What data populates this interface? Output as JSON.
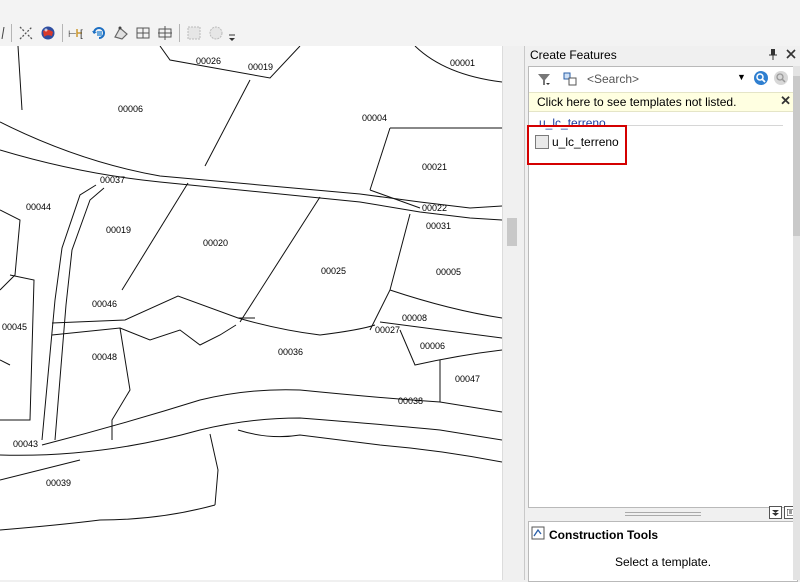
{
  "toolbar": {
    "icons": [
      "toolbar-edge-icon",
      "sketch-tool-icon",
      "globe-icon",
      "topology-icon",
      "rotate-icon",
      "reshape-icon",
      "split-icon",
      "align-icon",
      "disabled-tool-icon",
      "disabled-tool-2-icon",
      "overflow-icon"
    ]
  },
  "map": {
    "parcels": [
      {
        "id": "00026"
      },
      {
        "id": "00019"
      },
      {
        "id": "00001"
      },
      {
        "id": "00006"
      },
      {
        "id": "00004"
      },
      {
        "id": "00021"
      },
      {
        "id": "00037"
      },
      {
        "id": "00044"
      },
      {
        "id": "00022"
      },
      {
        "id": "00031"
      },
      {
        "id": "00019b",
        "label": "00019"
      },
      {
        "id": "00020"
      },
      {
        "id": "00025"
      },
      {
        "id": "00005"
      },
      {
        "id": "00046"
      },
      {
        "id": "00008"
      },
      {
        "id": "00045"
      },
      {
        "id": "00027"
      },
      {
        "id": "00006b",
        "label": "00006"
      },
      {
        "id": "00048"
      },
      {
        "id": "00036"
      },
      {
        "id": "00047"
      },
      {
        "id": "00038"
      },
      {
        "id": "00043"
      },
      {
        "id": "00039"
      }
    ]
  },
  "panel": {
    "title": "Create Features",
    "search_placeholder": "<Search>",
    "notice": "Click here to see templates not listed.",
    "layer_group": "u_lc_terreno",
    "template_label": "u_lc_terreno",
    "construction_title": "Construction Tools",
    "construction_placeholder": "Select a template."
  },
  "colors": {
    "highlight": "#d40000",
    "notice_bg": "#ffffe1",
    "layer_header": "#1f3fa0"
  }
}
